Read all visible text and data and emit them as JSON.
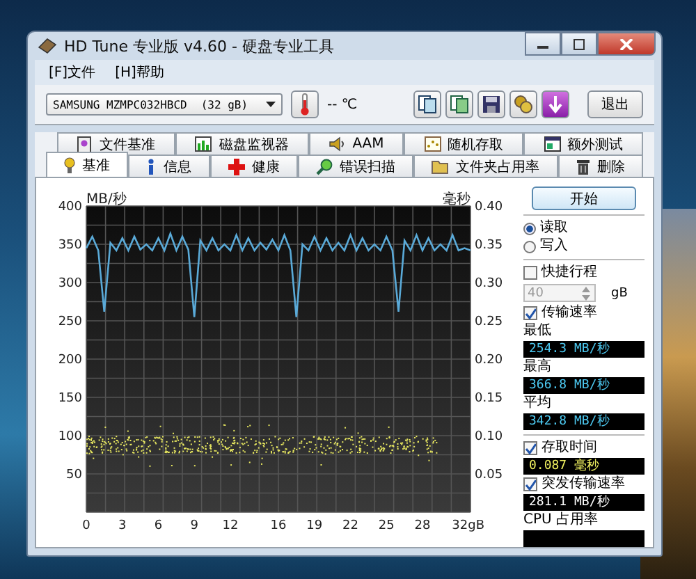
{
  "window": {
    "title": "HD Tune 专业版 v4.60 - 硬盘专业工具"
  },
  "menu": [
    "[F]文件",
    "[H]帮助"
  ],
  "toolbar": {
    "drive_name": "SAMSUNG MZMPC032HBCD",
    "drive_size": "(32 gB)",
    "temperature": "-- ℃",
    "exit_button": "退出"
  },
  "tab_rows": [
    {
      "tabs": [
        {
          "label": "文件基准",
          "selected": false
        },
        {
          "label": "磁盘监视器",
          "selected": false
        },
        {
          "label": "AAM",
          "selected": false
        },
        {
          "label": "随机存取",
          "selected": false
        },
        {
          "label": "额外测试",
          "selected": false
        }
      ]
    },
    {
      "tabs": [
        {
          "label": "基准",
          "selected": true
        },
        {
          "label": "信息",
          "selected": false
        },
        {
          "label": "健康",
          "selected": false
        },
        {
          "label": "错误扫描",
          "selected": false
        },
        {
          "label": "文件夹占用率",
          "selected": false
        },
        {
          "label": "删除",
          "selected": false
        }
      ]
    }
  ],
  "chart_data": {
    "type": "line",
    "ylabel": "MB/秒",
    "xlim": [
      0,
      32
    ],
    "ylim": [
      0,
      400
    ],
    "grid": true,
    "xticks": [
      0,
      3,
      6,
      9,
      12,
      16,
      19,
      22,
      25,
      28,
      {
        "value": 32,
        "label": "32gB"
      }
    ],
    "yticks": [
      50,
      100,
      150,
      200,
      250,
      300,
      350,
      400
    ],
    "x": [
      0,
      0.5,
      1,
      1.5,
      2,
      2.5,
      3,
      3.5,
      4,
      4.5,
      5,
      5.5,
      6,
      6.5,
      7,
      7.5,
      8,
      8.5,
      9,
      9.5,
      10,
      10.5,
      11,
      11.5,
      12,
      12.5,
      13,
      13.5,
      14,
      14.5,
      15,
      15.5,
      16,
      16.5,
      17,
      17.5,
      18,
      18.5,
      19,
      19.5,
      20,
      20.5,
      21,
      21.5,
      22,
      22.5,
      23,
      23.5,
      24,
      24.5,
      25,
      25.5,
      26,
      26.5,
      27,
      27.5,
      28,
      28.5,
      29,
      29.5,
      30,
      30.5,
      31,
      31.5,
      32
    ],
    "series": [
      {
        "color": "#5aaad8",
        "values": [
          345,
          360,
          342,
          262,
          352,
          342,
          358,
          342,
          360,
          343,
          350,
          342,
          358,
          342,
          364,
          342,
          360,
          343,
          255,
          355,
          342,
          358,
          342,
          350,
          342,
          362,
          342,
          358,
          342,
          352,
          343,
          356,
          342,
          362,
          342,
          255,
          350,
          342,
          360,
          342,
          358,
          342,
          352,
          342,
          362,
          342,
          358,
          342,
          350,
          342,
          360,
          342,
          262,
          355,
          342,
          362,
          342,
          358,
          342,
          350,
          342,
          362,
          342,
          345,
          342
        ]
      }
    ]
  },
  "access_time_axis": {
    "label": "毫秒",
    "ticks": [
      "0.40",
      "0.35",
      "0.30",
      "0.25",
      "0.20",
      "0.15",
      "0.10",
      "0.05"
    ]
  },
  "side_panel": {
    "start_button": "开始",
    "modes": [
      {
        "label": "读取",
        "selected": true
      },
      {
        "label": "写入",
        "selected": false
      }
    ],
    "short_stroke": {
      "label": "快捷行程",
      "checked": false,
      "value": "40",
      "unit": "gB",
      "disabled": true
    },
    "transfer_rate": {
      "label": "传输速率",
      "checked": true,
      "stats": [
        {
          "label": "最低",
          "value": "254.3",
          "unit": "MB/秒"
        },
        {
          "label": "最高",
          "value": "366.8",
          "unit": "MB/秒"
        },
        {
          "label": "平均",
          "value": "342.8",
          "unit": "MB/秒"
        }
      ]
    },
    "access_time": {
      "label": "存取时间",
      "checked": true,
      "value": "0.087",
      "unit": "毫秒"
    },
    "burst_rate": {
      "label": "突发传输速率",
      "checked": true,
      "value": "281.1",
      "unit": "MB/秒"
    },
    "cpu": {
      "label": "CPU 占用率"
    }
  }
}
